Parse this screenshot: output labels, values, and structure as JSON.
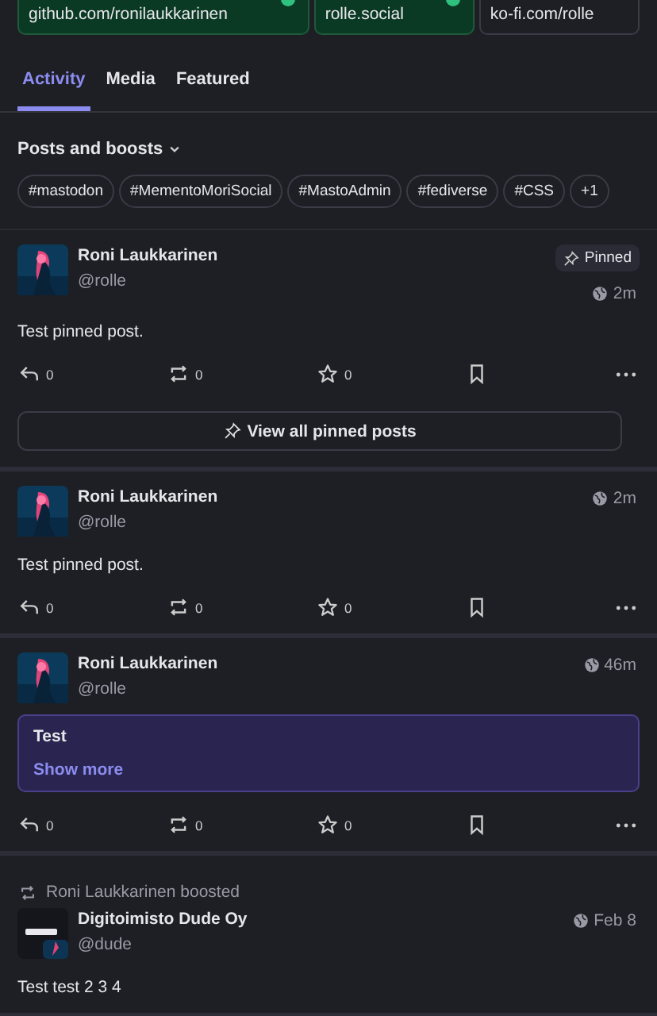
{
  "profile_links": [
    {
      "value": "github.com/ronilaukkarinen",
      "verified": true
    },
    {
      "value": "rolle.social",
      "verified": true
    },
    {
      "value": "ko-fi.com/rolle",
      "verified": false
    }
  ],
  "tabs": [
    {
      "label": "Activity",
      "selected": true
    },
    {
      "label": "Media",
      "selected": false
    },
    {
      "label": "Featured",
      "selected": false
    }
  ],
  "filter": {
    "label": "Posts and boosts"
  },
  "tags": [
    "#mastodon",
    "#MementoMoriSocial",
    "#MastoAdmin",
    "#fediverse",
    "#CSS",
    "+1"
  ],
  "posts": [
    {
      "kind": "post",
      "author": "Roni Laukkarinen",
      "handle": "@rolle",
      "pinned": true,
      "pinned_label": "Pinned",
      "time": "2m",
      "text": "Test pinned post.",
      "counts": {
        "replies": "0",
        "boosts": "0",
        "favourites": "0"
      },
      "footer_button": "View all pinned posts"
    },
    {
      "kind": "post",
      "author": "Roni Laukkarinen",
      "handle": "@rolle",
      "pinned": false,
      "time": "2m",
      "text": "Test pinned post.",
      "counts": {
        "replies": "0",
        "boosts": "0",
        "favourites": "0"
      }
    },
    {
      "kind": "warning",
      "author": "Roni Laukkarinen",
      "handle": "@rolle",
      "pinned": false,
      "time": "46m",
      "warning": "Test",
      "show_more": "Show more",
      "counts": {
        "replies": "0",
        "boosts": "0",
        "favourites": "0"
      }
    },
    {
      "kind": "boost",
      "boosted_by": "Roni Laukkarinen boosted",
      "author": "Digitoimisto Dude Oy",
      "handle": "@dude",
      "pinned": false,
      "time": "Feb 8",
      "text": "Test test 2 3 4"
    }
  ]
}
